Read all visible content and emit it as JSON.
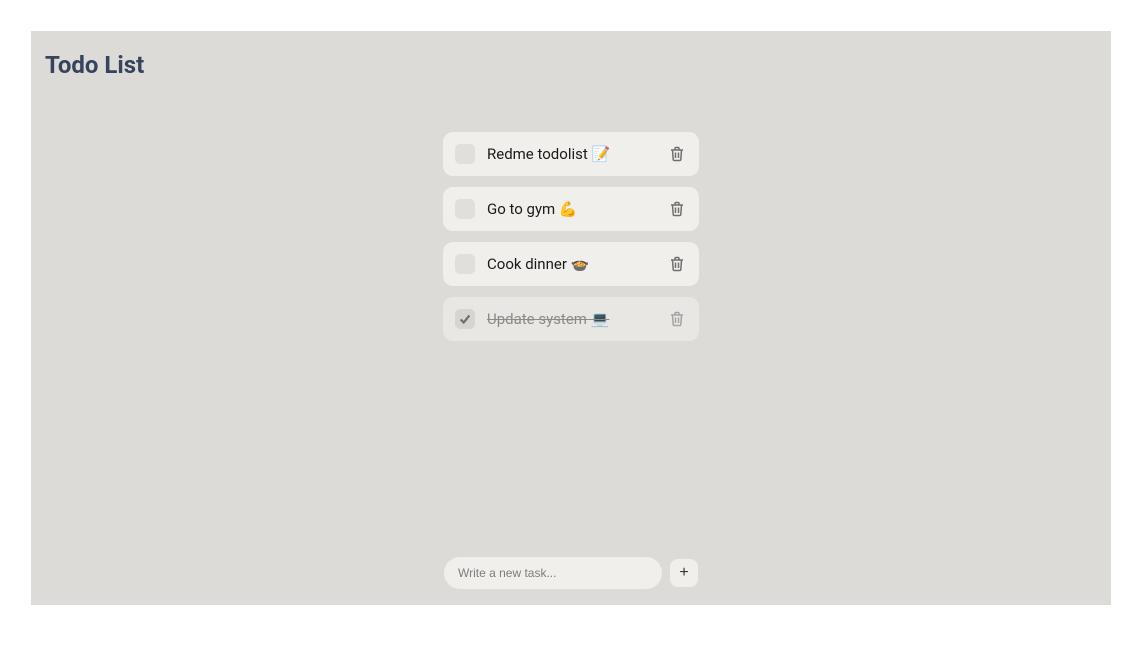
{
  "title": "Todo List",
  "tasks": [
    {
      "text": "Redme todolist 📝",
      "completed": false
    },
    {
      "text": "Go to gym 💪",
      "completed": false
    },
    {
      "text": "Cook dinner 🍲",
      "completed": false
    },
    {
      "text": "Update system 💻",
      "completed": true
    }
  ],
  "input": {
    "placeholder": "Write a new task..."
  },
  "addButton": {
    "label": "+"
  }
}
